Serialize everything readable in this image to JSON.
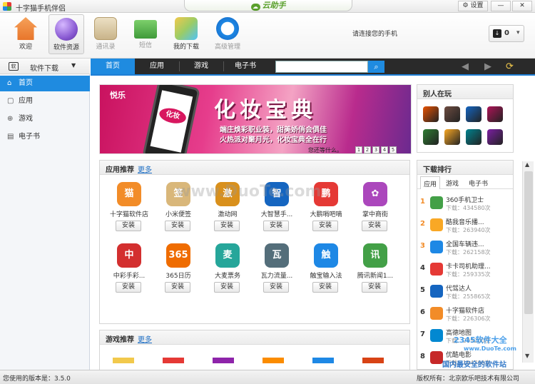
{
  "titlebar": {
    "title": "十字猫手机伴侣",
    "cloud_label": "云助手",
    "settings_label": "设置",
    "minimize": "—",
    "close": "✕"
  },
  "toolbar": {
    "items": [
      {
        "label": "欢迎",
        "icon": "home-icon",
        "color": "#e8762b"
      },
      {
        "label": "软件资源",
        "icon": "software-icon",
        "color": "#8a5bd3",
        "active": true
      },
      {
        "label": "通讯录",
        "icon": "contacts-icon",
        "color": "#c9b48a",
        "dim": true
      },
      {
        "label": "短信",
        "icon": "sms-icon",
        "color": "#43a047",
        "dim": true
      },
      {
        "label": "我的下载",
        "icon": "downloads-icon",
        "color": "#f2c94c"
      },
      {
        "label": "高级管理",
        "icon": "manage-icon",
        "color": "#1e88e5",
        "dim": true
      }
    ],
    "connect_prompt": "请连接您的手机",
    "download_count": "0"
  },
  "sidebar": {
    "header": "软件下载",
    "items": [
      {
        "label": "首页",
        "icon": "home-small-icon",
        "glyph": "⌂",
        "active": true
      },
      {
        "label": "应用",
        "icon": "app-icon",
        "glyph": "▢"
      },
      {
        "label": "游戏",
        "icon": "gamepad-icon",
        "glyph": "⊕"
      },
      {
        "label": "电子书",
        "icon": "book-icon",
        "glyph": "▤"
      }
    ]
  },
  "tabs": [
    {
      "label": "首页",
      "active": true
    },
    {
      "label": "应用"
    },
    {
      "label": "游戏"
    },
    {
      "label": "电子书"
    }
  ],
  "search": {
    "placeholder": ""
  },
  "banner": {
    "brand": "悦乐",
    "headline": "化妆宝典",
    "phone_text": "化妆",
    "line1": "端庄焕彩职业装，甜美娇俏会俱佳",
    "line2": "火热派对聚月光，化妆宝典全在行",
    "wait": "您还等什么。",
    "pages": [
      "1",
      "2",
      "3",
      "4",
      "5"
    ]
  },
  "app_panel": {
    "title": "应用推荐",
    "more": "更多",
    "apps": [
      {
        "name": "十字猫软件店",
        "color": "#f28c28",
        "glyph": "猫"
      },
      {
        "name": "小米便签",
        "color": "#d9b77a",
        "glyph": "签"
      },
      {
        "name": "激动网",
        "color": "#d9901c",
        "glyph": "激"
      },
      {
        "name": "大智慧手...",
        "color": "#1565c0",
        "glyph": "智"
      },
      {
        "name": "大鹏哨吧嘀",
        "color": "#e53935",
        "glyph": "鹏"
      },
      {
        "name": "掌中商街",
        "color": "#ab47bc",
        "glyph": "✿"
      },
      {
        "name": "中彩手彩...",
        "color": "#d32f2f",
        "glyph": "中"
      },
      {
        "name": "365日历",
        "color": "#ef6c00",
        "glyph": "365"
      },
      {
        "name": "大麦票务",
        "color": "#26a69a",
        "glyph": "麦"
      },
      {
        "name": "瓦力流量...",
        "color": "#546e7a",
        "glyph": "瓦"
      },
      {
        "name": "触宝输入法",
        "color": "#1e88e5",
        "glyph": "触"
      },
      {
        "name": "腾讯新闻1...",
        "color": "#43a047",
        "glyph": "讯"
      }
    ],
    "install_label": "安装"
  },
  "game_panel": {
    "title": "游戏推荐",
    "more": "更多"
  },
  "others_panel": {
    "title": "别人在玩",
    "games": [
      "#e65100",
      "#6d4c41",
      "#1565c0",
      "#ad1457",
      "#2e7d32",
      "#f9a825",
      "#00838f",
      "#7b1fa2"
    ]
  },
  "rank_panel": {
    "title": "下载排行",
    "tabs": [
      "应用",
      "游戏",
      "电子书"
    ],
    "items": [
      {
        "rank": "1",
        "name": "360手机卫士",
        "count": "下载：434580次",
        "color": "#43a047"
      },
      {
        "rank": "2",
        "name": "酷我音乐播...",
        "count": "下载：263940次",
        "color": "#f9a825"
      },
      {
        "rank": "3",
        "name": "全国车辆违...",
        "count": "下载：262158次",
        "color": "#1e88e5"
      },
      {
        "rank": "4",
        "name": "卡卡司机助理...",
        "count": "下载：259335次",
        "color": "#e53935"
      },
      {
        "rank": "5",
        "name": "代驾达人",
        "count": "下载：255865次",
        "color": "#1565c0"
      },
      {
        "rank": "6",
        "name": "十字猫软件店",
        "count": "下载：226306次",
        "color": "#f28c28"
      },
      {
        "rank": "7",
        "name": "高德地图",
        "count": "下载：205200次",
        "color": "#0288d1"
      },
      {
        "rank": "8",
        "name": "优酷电影",
        "count": "下载：194798次",
        "color": "#c62828"
      }
    ]
  },
  "status": {
    "version": "您使用的版本是：3.5.0",
    "copyright": "版权所有：北京欧乐吧技术有限公司"
  },
  "watermark": {
    "main": "www.DuoTe.com",
    "corner1": "2345软件大全",
    "corner2": "www.DuoTe.com",
    "corner3": "国内最安全的软件站"
  }
}
